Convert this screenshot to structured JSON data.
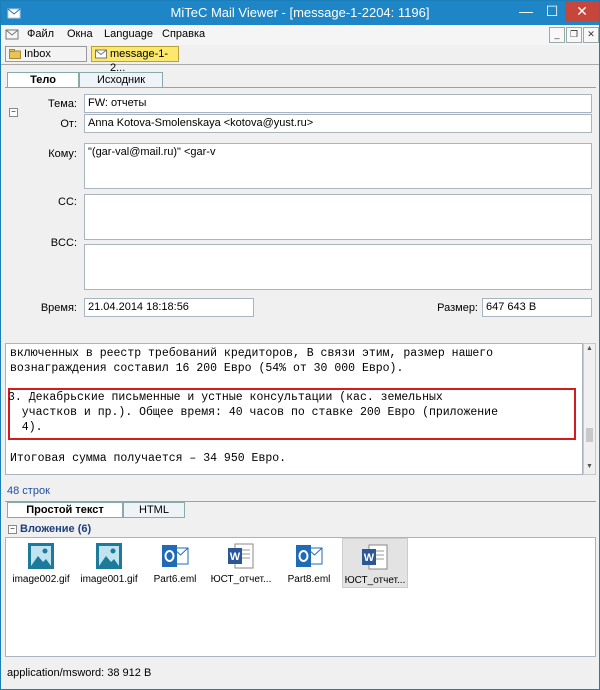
{
  "window": {
    "title": "MiTeC Mail Viewer - [message-1-2204: 1196]",
    "min_label": "—",
    "max_label": "☐",
    "close_label": "✕"
  },
  "menu": {
    "items": [
      "Файл",
      "Окна",
      "Language",
      "Справка"
    ],
    "mdi_buttons": [
      "_",
      "❐",
      "✕"
    ]
  },
  "doc_tabs": {
    "inbox": "Inbox",
    "message": "message-1-2..."
  },
  "view_tabs": {
    "body": "Тело",
    "source": "Исходник"
  },
  "header": {
    "subject_label": "Тема:",
    "subject_value": "FW: отчеты",
    "from_label": "От:",
    "from_value": "Anna Kotova-Smolenskaya <kotova@yust.ru>",
    "to_label": "Кому:",
    "to_value": "\"(gar-val@mail.ru)\" <gar-v",
    "cc_label": "CC:",
    "cc_value": "",
    "bcc_label": "BCC:",
    "bcc_value": "",
    "time_label": "Время:",
    "time_value": "21.04.2014 18:18:56",
    "size_label": "Размер:",
    "size_value": "647 643 B"
  },
  "body": {
    "lines": [
      "включенных в реестр требований кредиторов, В связи этим, размер нашего",
      "вознаграждения составил 16 200 Евро (54% от 30 000 Евро).",
      "3. Декабрьские письменные и устные консультации (кас. земельных",
      "  участков и пр.). Общее время: 40 часов по ставке 200 Евро (приложение",
      "  4).",
      "Итоговая сумма получается – 34 950 Евро."
    ]
  },
  "line_count": "48 строк",
  "format_tabs": {
    "plain": "Простой текст",
    "html": "HTML"
  },
  "attachments": {
    "header": "Вложение (6)",
    "items": [
      {
        "name": "image002.gif",
        "icon": "image-icon"
      },
      {
        "name": "image001.gif",
        "icon": "image-icon"
      },
      {
        "name": "Part6.eml",
        "icon": "outlook-icon"
      },
      {
        "name": "ЮСТ_отчет...",
        "icon": "word-icon"
      },
      {
        "name": "Part8.eml",
        "icon": "outlook-icon"
      },
      {
        "name": "ЮСТ_отчет...",
        "icon": "word-icon"
      }
    ]
  },
  "status": "application/msword: 38 912 B",
  "colors": {
    "titlebar": "#1e86c6",
    "highlight_border": "#d21d1d",
    "active_tab": "#fbe86d"
  }
}
